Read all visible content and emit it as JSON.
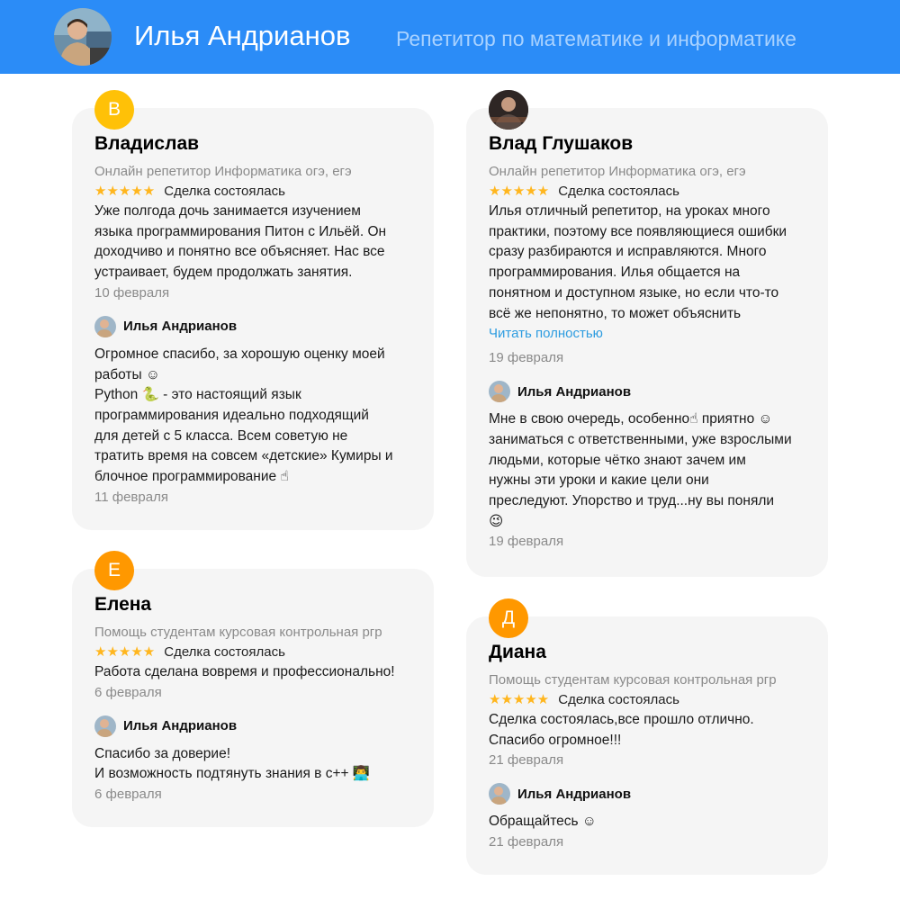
{
  "header": {
    "name": "Илья Андрианов",
    "subtitle": "Репетитор по математике и информатике"
  },
  "reviews": [
    {
      "avatar_letter": "В",
      "reviewer": "Владислав",
      "service": "Онлайн репетитор Информатика огэ, егэ",
      "stars": "★★★★★",
      "status": "Сделка состоялась",
      "text": [
        "Уже полгода дочь занимается изучением",
        "языка программирования Питон с Ильёй. Он",
        "доходчиво и понятно все объясняет. Нас все",
        "устраивает, будем продолжать занятия."
      ],
      "date": "10 февраля",
      "reply": {
        "author": "Илья Андрианов",
        "text": [
          "Огромное спасибо, за хорошую оценку моей",
          "работы ☺",
          "Python 🐍 - это настоящий язык",
          "программирования идеально подходящий",
          "для детей с 5 класса. Всем советую не",
          "тратить время на совсем «детские» Кумиры и",
          "блочное программирование ☝"
        ],
        "date": "11 февраля"
      }
    },
    {
      "avatar_letter": "Е",
      "reviewer": "Елена",
      "service": "Помощь студентам курсовая контрольная ргр",
      "stars": "★★★★★",
      "status": "Сделка состоялась",
      "text": [
        "Работа сделана вовремя и профессионально!"
      ],
      "date": "6 февраля",
      "reply": {
        "author": "Илья Андрианов",
        "text": [
          "Спасибо за доверие!",
          "И возможность подтянуть знания в с++ 👨‍💻"
        ],
        "date": "6 февраля"
      }
    },
    {
      "avatar_letter": "",
      "reviewer": "Влад Глушаков",
      "service": "Онлайн репетитор Информатика огэ, егэ",
      "stars": "★★★★★",
      "status": "Сделка состоялась",
      "text": [
        "Илья отличный репетитор, на уроках много",
        "практики, поэтому все появляющиеся ошибки",
        "сразу разбираются и исправляются. Много",
        "программирования. Илья общается на",
        "понятном и доступном языке, но если что-то",
        "всё же непонятно, то может объяснить"
      ],
      "read_more": "Читать полностью",
      "date": "19 февраля",
      "reply": {
        "author": "Илья Андрианов",
        "text": [
          "Мне в свою очередь, особенно☝ приятно ☺",
          "заниматься с ответственными, уже взрослыми",
          "людьми, которые чётко знают зачем им",
          "нужны эти уроки и какие цели они",
          "преследуют. Упорство и труд...ну вы поняли",
          "😉"
        ],
        "date": "19 февраля"
      }
    },
    {
      "avatar_letter": "Д",
      "reviewer": "Диана",
      "service": "Помощь студентам курсовая контрольная ргр",
      "stars": "★★★★★",
      "status": "Сделка состоялась",
      "text": [
        "Сделка состоялась,все прошло отлично.",
        "Спасибо огромное!!!"
      ],
      "date": "21 февраля",
      "reply": {
        "author": "Илья Андрианов",
        "text": [
          "Обращайтесь ☺"
        ],
        "date": "21 февраля"
      }
    }
  ],
  "colors": {
    "header_bg": "#2b8cf7",
    "star": "#ffb61e",
    "link": "#2d9ce0",
    "avatar_yellow": "#ffc107",
    "avatar_orange": "#ff9800"
  }
}
